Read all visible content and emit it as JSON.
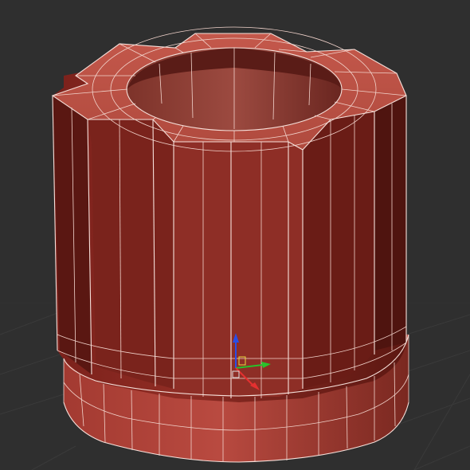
{
  "viewport": {
    "background": "#2f2f2f",
    "grid_color": "#3a3a3a",
    "mode": "perspective",
    "display": "shaded-wireframe"
  },
  "object": {
    "shape": "gear-cylinder",
    "teeth": 8,
    "base_color": "#8a2a22",
    "light_color": "#c2584a",
    "dark_color": "#5c1712",
    "wire_color": "#f2d4cc",
    "selected": true
  },
  "gizmo": {
    "x_color": "#e53030",
    "y_color": "#29c12b",
    "z_color": "#2a4de6",
    "pivot_icon": "pivot-box-icon"
  }
}
